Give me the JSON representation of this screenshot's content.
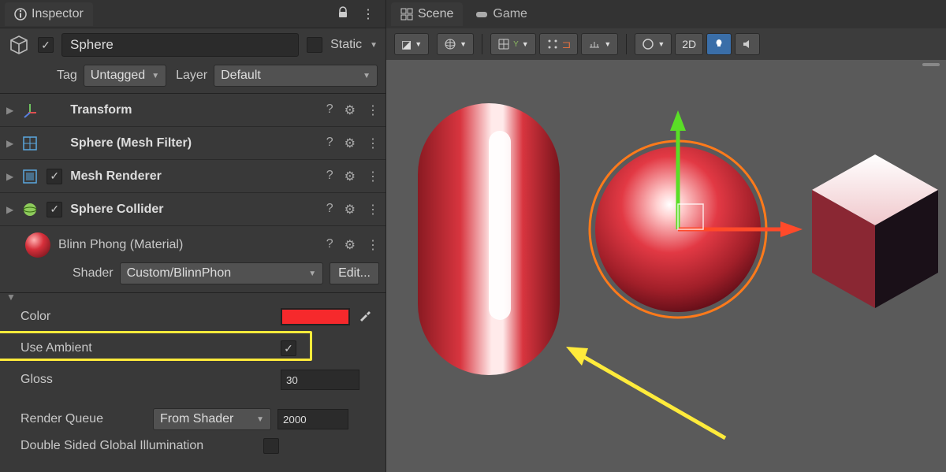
{
  "inspector": {
    "tab_label": "Inspector",
    "object_name": "Sphere",
    "static_label": "Static",
    "tag_label": "Tag",
    "tag_value": "Untagged",
    "layer_label": "Layer",
    "layer_value": "Default"
  },
  "components": {
    "transform": "Transform",
    "mesh_filter": "Sphere (Mesh Filter)",
    "mesh_renderer": "Mesh Renderer",
    "sphere_collider": "Sphere Collider"
  },
  "material": {
    "name": "Blinn Phong (Material)",
    "shader_label": "Shader",
    "shader_value": "Custom/BlinnPhon",
    "edit_btn": "Edit...",
    "color_label": "Color",
    "color_value": "#f6292c",
    "use_ambient_label": "Use Ambient",
    "use_ambient_checked": true,
    "gloss_label": "Gloss",
    "gloss_value": "30",
    "render_queue_label": "Render Queue",
    "render_queue_mode": "From Shader",
    "render_queue_value": "2000",
    "dsgi_label": "Double Sided Global Illumination"
  },
  "scene": {
    "scene_tab": "Scene",
    "game_tab": "Game",
    "btn_2d": "2D"
  }
}
